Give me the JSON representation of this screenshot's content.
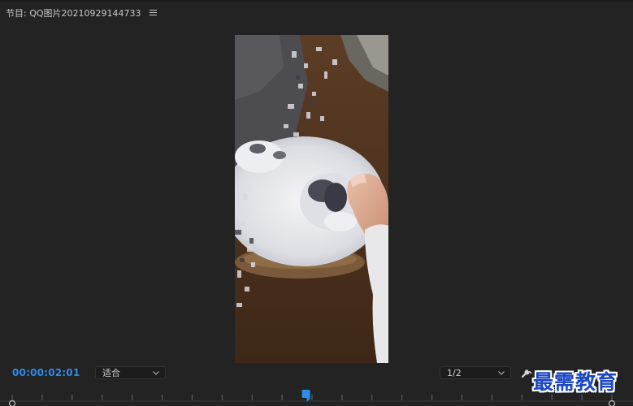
{
  "panel": {
    "title": "节目: QQ图片20210929144733",
    "menu_icon": "hamburger-menu-icon"
  },
  "video": {
    "description_icon": "video-preview"
  },
  "controls": {
    "timecode": "00:00:02:01",
    "zoom": {
      "selected": "适合"
    },
    "resolution": {
      "selected": "1/2"
    },
    "settings_icon": "wrench-icon",
    "playhead_position": 0.49
  },
  "watermark": {
    "text": "最需教育"
  },
  "colors": {
    "background": "#232323",
    "timecode": "#2d8ceb",
    "playhead": "#2d8ceb",
    "watermark": "#1b46c4"
  }
}
